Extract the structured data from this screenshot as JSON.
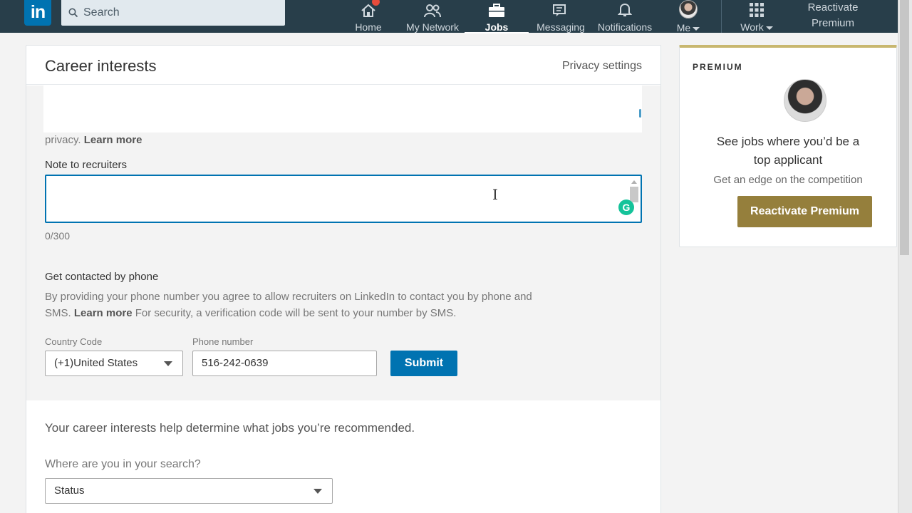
{
  "nav": {
    "logo_text": "in",
    "search_placeholder": "Search",
    "items": [
      {
        "label": "Home",
        "icon": "home-icon"
      },
      {
        "label": "My Network",
        "icon": "people-icon"
      },
      {
        "label": "Jobs",
        "icon": "briefcase-icon"
      },
      {
        "label": "Messaging",
        "icon": "chat-icon"
      },
      {
        "label": "Notifications",
        "icon": "bell-icon"
      },
      {
        "label": "Me",
        "icon": "avatar"
      },
      {
        "label": "Work",
        "icon": "grid-icon"
      }
    ],
    "reactivate_line1": "Reactivate",
    "reactivate_line2": "Premium"
  },
  "card": {
    "title": "Career interests",
    "privacy_settings": "Privacy settings",
    "privacy_text": "privacy.",
    "learn_more": "Learn more",
    "note_label": "Note to recruiters",
    "note_value": "",
    "counter": "0/300",
    "phone_title": "Get contacted by phone",
    "phone_desc_1": "By providing your phone number you agree to allow recruiters on LinkedIn to contact you by phone and SMS.",
    "phone_desc_learn": "Learn more",
    "phone_desc_2": "For security, a verification code will be sent to your number by SMS.",
    "country_code_label": "Country Code",
    "country_code_value": "(+1)United States",
    "phone_label": "Phone number",
    "phone_value": "516-242-0639",
    "submit": "Submit",
    "recommend_text": "Your career interests help determine what jobs you’re recommended.",
    "where_label": "Where are you in your search?",
    "status_value": "Status"
  },
  "premium": {
    "label": "PREMIUM",
    "headline_1": "See jobs where you’d be a",
    "headline_2": "top applicant",
    "sub": "Get an edge on the competition",
    "button": "Reactivate Premium"
  },
  "colors": {
    "nav_bg": "#283e4a",
    "brand_blue": "#0073b1",
    "premium_gold": "#957f3c"
  }
}
